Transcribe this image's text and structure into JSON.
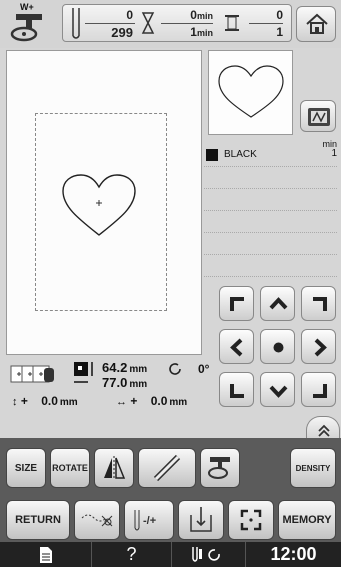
{
  "status": {
    "stitch_total": "0",
    "stitch_count": "299",
    "time_elapsed": "0",
    "time_elapsed_unit": "min",
    "time_total": "1",
    "time_total_unit": "min",
    "color_current": "0",
    "color_total": "1",
    "presser_label": "W+"
  },
  "colors": [
    {
      "name": "BLACK",
      "swatch": "#111111"
    }
  ],
  "color_time_unit": "min",
  "color_time_value": "1",
  "pattern": {
    "width": "64.2",
    "height": "77.0",
    "size_unit": "mm",
    "rotation": "0°",
    "offset_y": "0.0",
    "offset_x": "0.0",
    "offset_unit": "mm",
    "offset_y_sign": "+",
    "offset_x_sign": "+"
  },
  "tools": {
    "size": "SIZE",
    "rotate": "ROTATE",
    "density": "DENSITY",
    "return": "RETURN",
    "memory": "MEMORY"
  },
  "clock": "12:00",
  "help_label": "?"
}
